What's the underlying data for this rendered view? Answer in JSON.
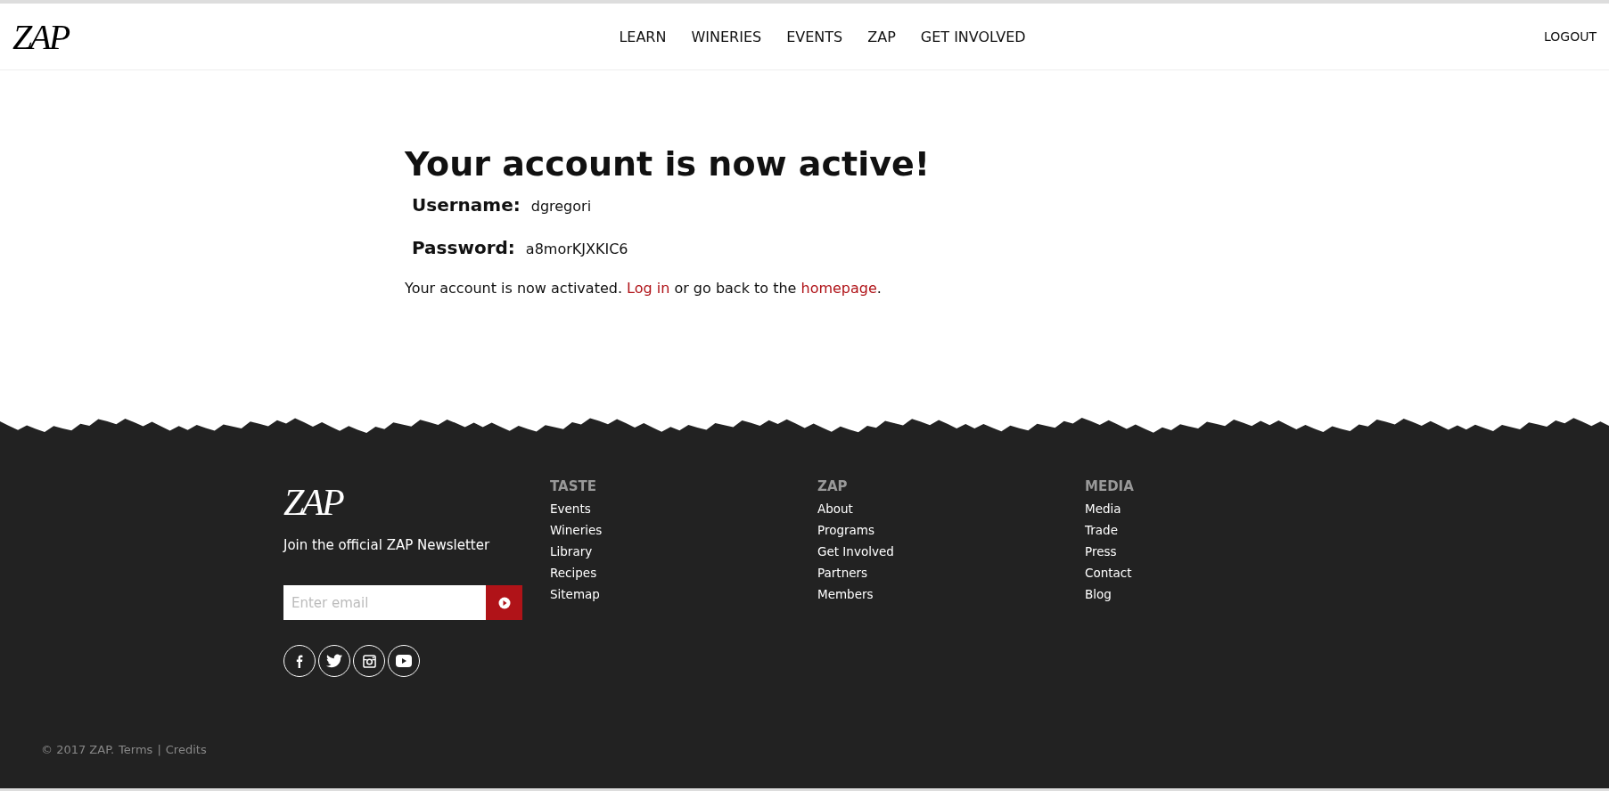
{
  "header": {
    "logo": "ZAP",
    "nav": [
      {
        "label": "LEARN"
      },
      {
        "label": "WINERIES"
      },
      {
        "label": "EVENTS"
      },
      {
        "label": "ZAP"
      },
      {
        "label": "GET INVOLVED"
      }
    ],
    "logout": "LOGOUT"
  },
  "main": {
    "title": "Your account is now active!",
    "fields": [
      {
        "label": "Username:",
        "value": "dgregori"
      },
      {
        "label": "Password:",
        "value": "a8morKJXKIC6"
      }
    ],
    "message": {
      "before": "Your account is now activated.",
      "link1": "Log in",
      "middle": "or go back to the",
      "link2": "homepage",
      "after": "."
    }
  },
  "footer": {
    "logo": "ZAP",
    "newsletter": "Join the official ZAP Newsletter",
    "email": {
      "placeholder": "Enter email"
    },
    "columns": [
      {
        "heading": "TASTE",
        "links": [
          "Events",
          "Wineries",
          "Library",
          "Recipes",
          "Sitemap"
        ]
      },
      {
        "heading": "ZAP",
        "links": [
          "About",
          "Programs",
          "Get Involved",
          "Partners",
          "Members"
        ]
      },
      {
        "heading": "MEDIA",
        "links": [
          "Media",
          "Trade",
          "Press",
          "Contact",
          "Blog"
        ]
      }
    ],
    "social": [
      {
        "kind": "facebook"
      },
      {
        "kind": "twitter"
      },
      {
        "kind": "instagram"
      },
      {
        "kind": "youtube"
      }
    ],
    "copyright": "© 2017 ZAP.",
    "legal_links": [
      "Terms",
      "Credits"
    ],
    "separator": "|"
  }
}
